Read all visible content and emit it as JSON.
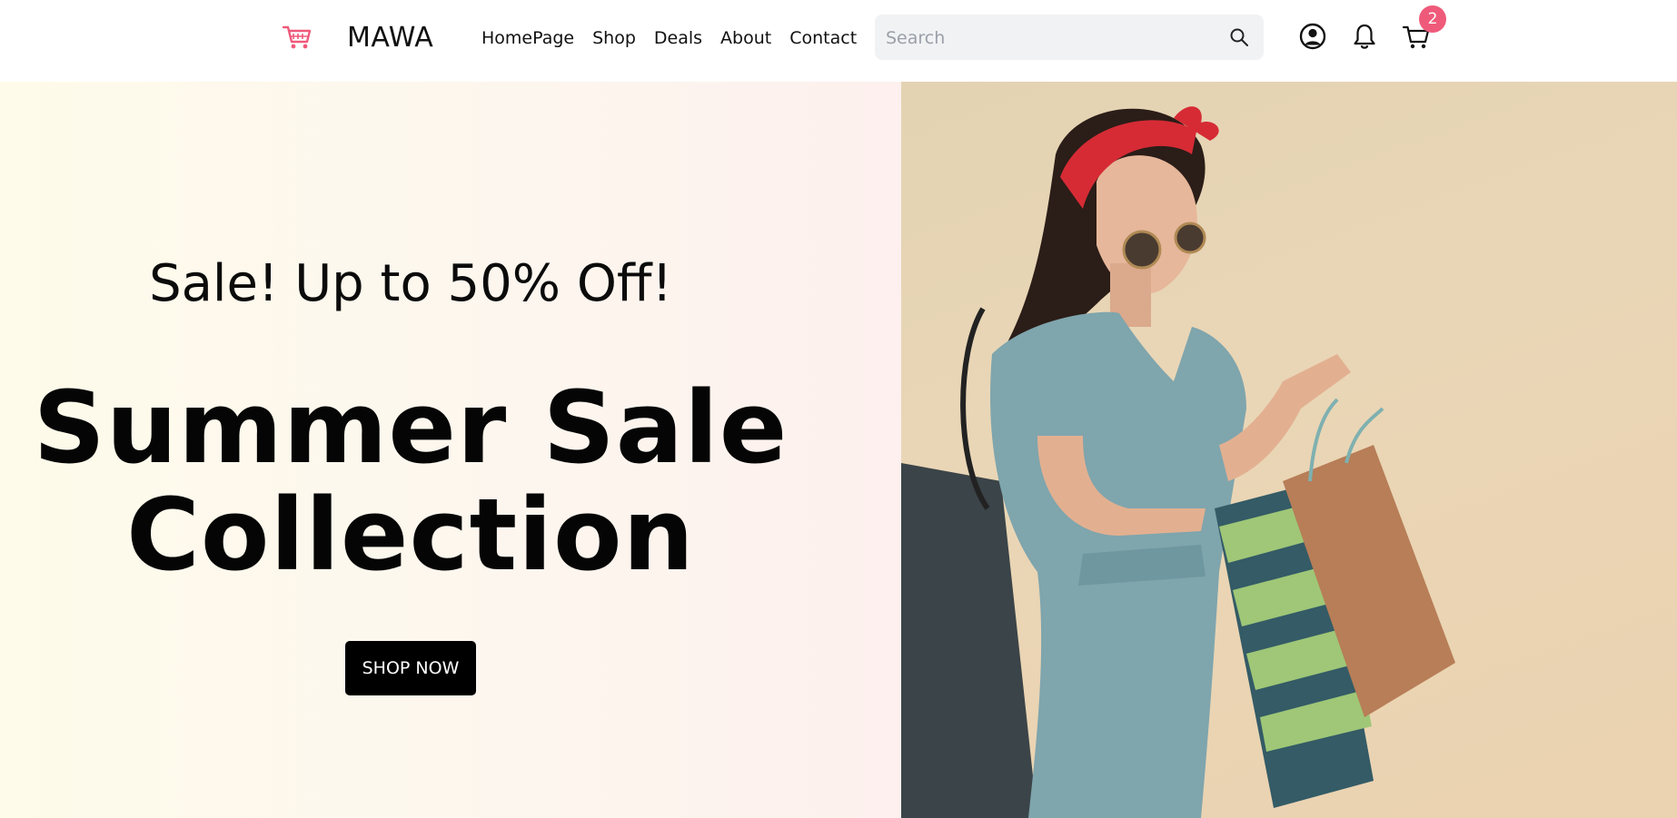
{
  "header": {
    "brand": "MAWA",
    "nav": [
      "HomePage",
      "Shop",
      "Deals",
      "About",
      "Contact"
    ],
    "search_placeholder": "Search",
    "cart_count": "2"
  },
  "hero": {
    "subtitle": "Sale! Up to 50% Off!",
    "title_line1": "Summer Sale",
    "title_line2": "Collection",
    "button": "SHOP NOW"
  },
  "colors": {
    "accent": "#ef5a7a",
    "button_bg": "#000000",
    "search_bg": "#f1f2f4"
  },
  "icons": {
    "logo": "shopping-cart-icon",
    "search": "search-icon",
    "account": "user-circle-icon",
    "notifications": "bell-icon",
    "cart": "cart-icon"
  }
}
